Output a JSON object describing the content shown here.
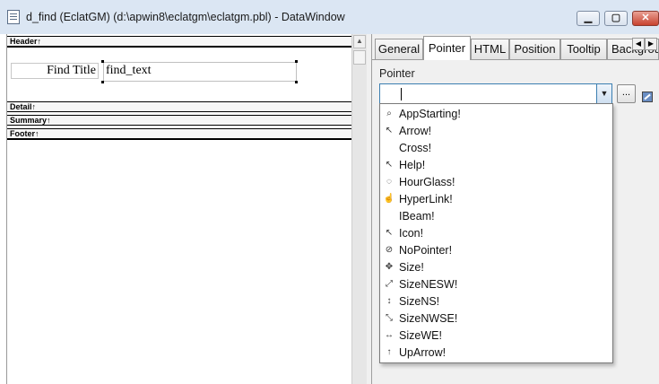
{
  "window": {
    "title": "d_find  (EclatGM) (d:\\apwin8\\eclatgm\\eclatgm.pbl) - DataWindow",
    "icons": {
      "app": "datawindow-icon",
      "minimize": "minimize-icon",
      "maximize": "maximize-icon",
      "close": "close-icon"
    }
  },
  "design": {
    "bands": [
      "Header↑",
      "Detail↑",
      "Summary↑",
      "Footer↑"
    ],
    "header_controls": {
      "label": "Find Title",
      "field": "find_text"
    }
  },
  "properties": {
    "tabs": [
      "General",
      "Pointer",
      "HTML",
      "Position",
      "Tooltip",
      "Background"
    ],
    "active_tab": "Pointer",
    "pointer_label": "Pointer",
    "pointer_value": "",
    "browse_button": "...",
    "options": [
      {
        "label": "AppStarting!",
        "icon": "app-starting-cursor-icon",
        "glyph": "⌕"
      },
      {
        "label": "Arrow!",
        "icon": "arrow-cursor-icon",
        "glyph": "↖"
      },
      {
        "label": "Cross!",
        "icon": "cross-cursor-icon",
        "glyph": ""
      },
      {
        "label": "Help!",
        "icon": "help-cursor-icon",
        "glyph": "↖"
      },
      {
        "label": "HourGlass!",
        "icon": "hourglass-cursor-icon",
        "glyph": "◌"
      },
      {
        "label": "HyperLink!",
        "icon": "hand-cursor-icon",
        "glyph": "☝"
      },
      {
        "label": "IBeam!",
        "icon": "ibeam-cursor-icon",
        "glyph": ""
      },
      {
        "label": "Icon!",
        "icon": "icon-cursor-icon",
        "glyph": "↖"
      },
      {
        "label": "NoPointer!",
        "icon": "no-pointer-cursor-icon",
        "glyph": "⊘"
      },
      {
        "label": "Size!",
        "icon": "size-cursor-icon",
        "glyph": "✥"
      },
      {
        "label": "SizeNESW!",
        "icon": "size-nesw-cursor-icon",
        "glyph": "⤢"
      },
      {
        "label": "SizeNS!",
        "icon": "size-ns-cursor-icon",
        "glyph": "↕"
      },
      {
        "label": "SizeNWSE!",
        "icon": "size-nwse-cursor-icon",
        "glyph": "⤡"
      },
      {
        "label": "SizeWE!",
        "icon": "size-we-cursor-icon",
        "glyph": "↔"
      },
      {
        "label": "UpArrow!",
        "icon": "up-arrow-cursor-icon",
        "glyph": "↑"
      }
    ]
  }
}
